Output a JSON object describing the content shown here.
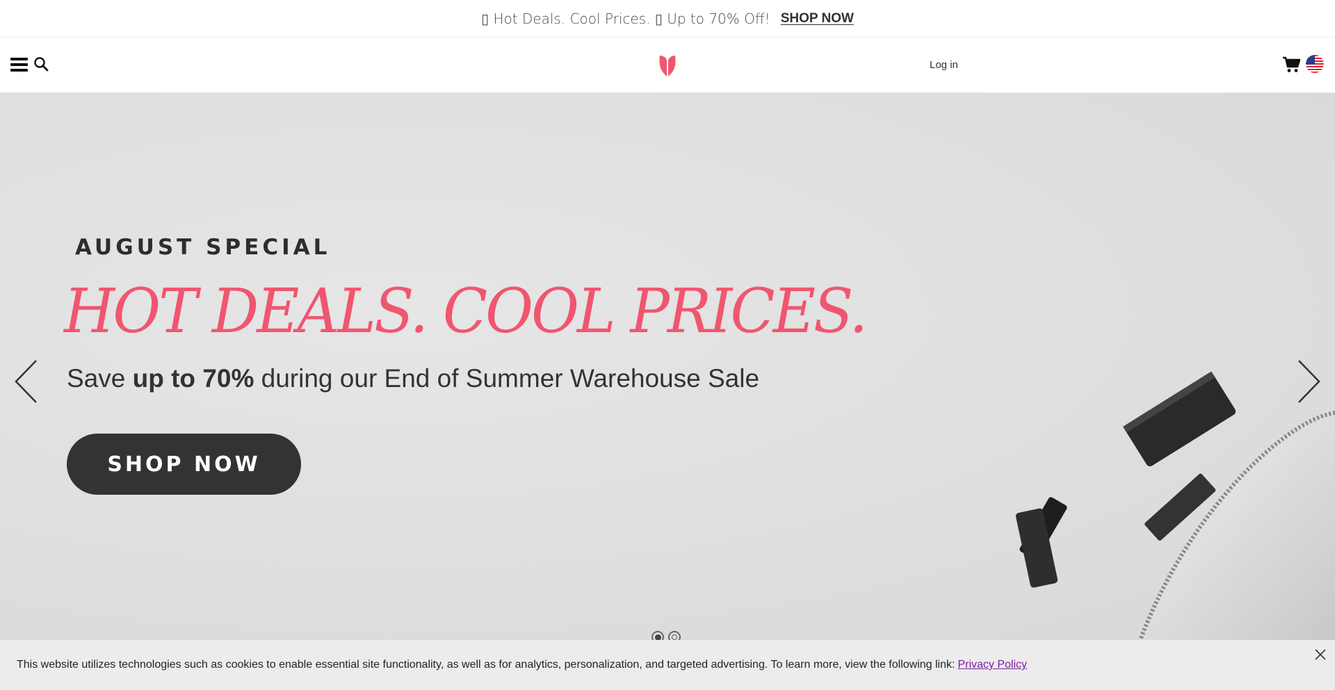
{
  "promo": {
    "text": "▯ Hot Deals. Cool Prices. ▯ Up to 70% Off!",
    "link": "SHOP NOW"
  },
  "header": {
    "login": "Log in",
    "icons": [
      "menu-icon",
      "search-icon",
      "younique-logo",
      "cart-icon",
      "us-flag-icon"
    ]
  },
  "hero": {
    "eyebrow": "AUGUST SPECIAL",
    "title": "HOT DEALS. COOL PRICES.",
    "subtitle_before": "Save ",
    "subtitle_bold": "up to 70%",
    "subtitle_after": " during our End of Summer Warehouse Sale",
    "cta": "SHOP NOW",
    "accent_color": "#f0566f",
    "cta_color": "#333333",
    "slides_total": 2,
    "slide_active": 1
  },
  "cookie": {
    "text": "This website utilizes technologies such as cookies to enable essential site functionality, as well as for analytics, personalization, and targeted advertising. To learn more, view the following link:",
    "link": "Privacy Policy"
  }
}
